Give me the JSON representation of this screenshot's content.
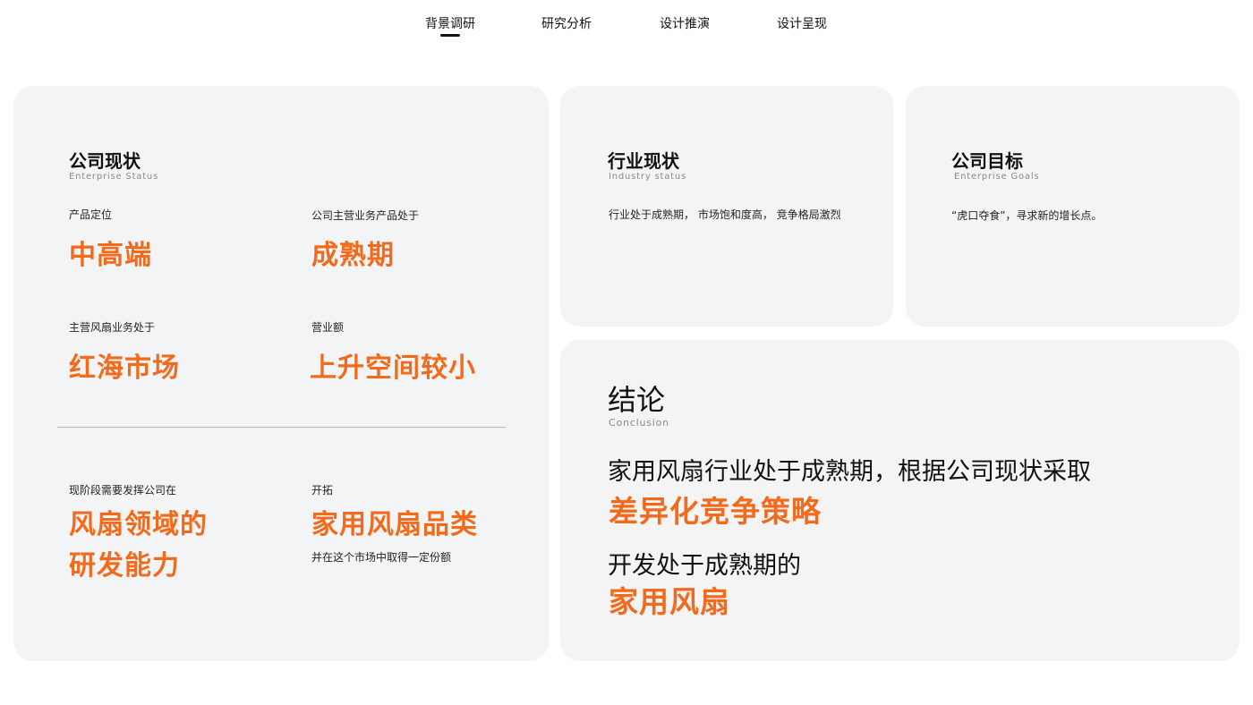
{
  "nav": {
    "tabs": [
      {
        "label": "背景调研",
        "active": true
      },
      {
        "label": "研究分析",
        "active": false
      },
      {
        "label": "设计推演",
        "active": false
      },
      {
        "label": "设计呈现",
        "active": false
      }
    ]
  },
  "company_status": {
    "title": "公司现状",
    "subtitle": "Enterprise Status",
    "items": [
      {
        "label": "产品定位",
        "value": "中高端"
      },
      {
        "label": "公司主营业务产品处于",
        "value": "成熟期"
      },
      {
        "label": "主营风扇业务处于",
        "value": "红海市场"
      },
      {
        "label": "营业额",
        "value": "上升空间较小"
      }
    ],
    "bottom_left": {
      "label": "现阶段需要发挥公司在",
      "value_line1": "风扇领域的",
      "value_line2": "研发能力"
    },
    "bottom_right": {
      "label": "开拓",
      "value": "家用风扇品类",
      "note": "并在这个市场中取得一定份额"
    }
  },
  "industry_status": {
    "title": "行业现状",
    "subtitle": "Industry status",
    "text": "行业处于成熟期， 市场饱和度高， 竞争格局激烈"
  },
  "company_goals": {
    "title": "公司目标",
    "subtitle": "Enterprise Goals",
    "text": "“虎口夺食”，寻求新的增长点。"
  },
  "conclusion": {
    "title": "结论",
    "subtitle": "Conclusion",
    "line1": "家用风扇行业处于成熟期，根据公司现状采取",
    "highlight1": "差异化竞争策略",
    "line2": "开发处于成熟期的",
    "highlight2": "家用风扇"
  },
  "colors": {
    "accent": "#f26a1b",
    "card_bg": "#f4f4f5",
    "text": "#111111"
  }
}
